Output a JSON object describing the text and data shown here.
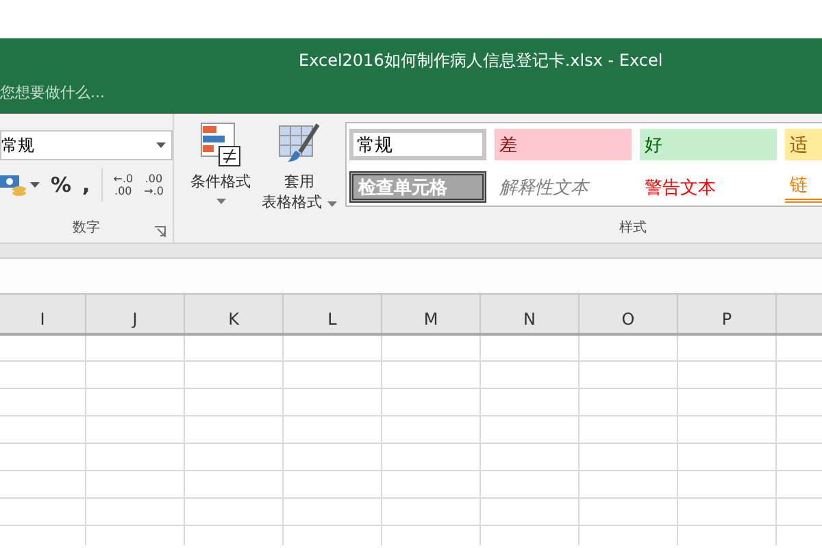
{
  "window": {
    "title": "Excel2016如何制作病人信息登记卡.xlsx - Excel"
  },
  "tell_me": {
    "placeholder": "您想要做什么..."
  },
  "number_group": {
    "format": "常规",
    "label": "数字",
    "buttons": [
      {
        "kind": "currency"
      },
      {
        "kind": "text",
        "label": "%"
      },
      {
        "kind": "text",
        "label": ","
      },
      {
        "kind": "decimal",
        "lines": [
          "←.0",
          ".00"
        ]
      },
      {
        "kind": "decimal",
        "lines": [
          ".00",
          "→.0"
        ]
      }
    ]
  },
  "conditional_format": {
    "label": "条件格式"
  },
  "format_as_table": {
    "lines": [
      "套用",
      "表格格式"
    ]
  },
  "styles": {
    "label": "样式",
    "items": [
      {
        "label": "常规",
        "kind": "normal",
        "selected": true
      },
      {
        "label": "差",
        "kind": "bad",
        "selected": false
      },
      {
        "label": "好",
        "kind": "good",
        "selected": false
      },
      {
        "label": "适",
        "kind": "neutral",
        "selected": false
      },
      {
        "label": "检查单元格",
        "kind": "check",
        "selected": false
      },
      {
        "label": "解释性文本",
        "kind": "explanatory",
        "selected": false
      },
      {
        "label": "警告文本",
        "kind": "warning",
        "selected": false
      },
      {
        "label": "链",
        "kind": "link",
        "selected": false
      }
    ]
  },
  "columns": [
    "I",
    "J",
    "K",
    "L",
    "M",
    "N",
    "O",
    "P",
    ""
  ]
}
